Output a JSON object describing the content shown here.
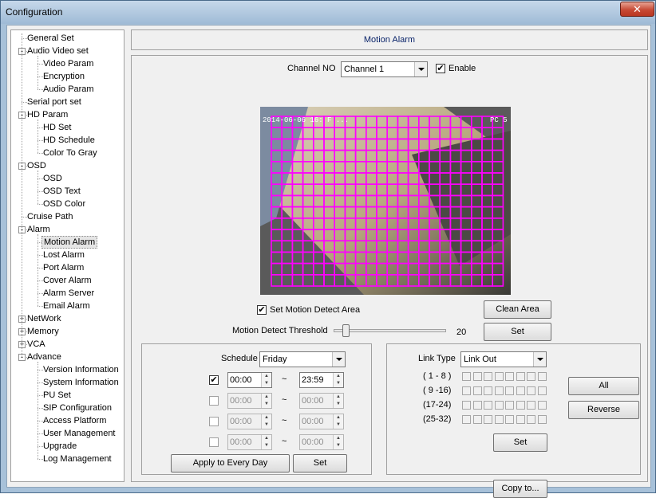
{
  "window": {
    "title": "Configuration",
    "close": "✕"
  },
  "tree": [
    {
      "label": "General Set",
      "level": 0,
      "exp": null
    },
    {
      "label": "Audio Video set",
      "level": 0,
      "exp": "-"
    },
    {
      "label": "Video Param",
      "level": 1,
      "exp": null
    },
    {
      "label": "Encryption",
      "level": 1,
      "exp": null
    },
    {
      "label": "Audio Param",
      "level": 1,
      "exp": null
    },
    {
      "label": "Serial port set",
      "level": 0,
      "exp": null
    },
    {
      "label": "HD Param",
      "level": 0,
      "exp": "-"
    },
    {
      "label": "HD Set",
      "level": 1,
      "exp": null
    },
    {
      "label": "HD Schedule",
      "level": 1,
      "exp": null
    },
    {
      "label": "Color To Gray",
      "level": 1,
      "exp": null
    },
    {
      "label": "OSD",
      "level": 0,
      "exp": "-"
    },
    {
      "label": "OSD",
      "level": 1,
      "exp": null
    },
    {
      "label": "OSD Text",
      "level": 1,
      "exp": null
    },
    {
      "label": "OSD Color",
      "level": 1,
      "exp": null
    },
    {
      "label": "Cruise Path",
      "level": 0,
      "exp": null
    },
    {
      "label": "Alarm",
      "level": 0,
      "exp": "-"
    },
    {
      "label": "Motion Alarm",
      "level": 1,
      "exp": null,
      "selected": true
    },
    {
      "label": "Lost Alarm",
      "level": 1,
      "exp": null
    },
    {
      "label": "Port Alarm",
      "level": 1,
      "exp": null
    },
    {
      "label": "Cover Alarm",
      "level": 1,
      "exp": null
    },
    {
      "label": "Alarm Server",
      "level": 1,
      "exp": null
    },
    {
      "label": "Email Alarm",
      "level": 1,
      "exp": null
    },
    {
      "label": "NetWork",
      "level": 0,
      "exp": "+"
    },
    {
      "label": "Memory",
      "level": 0,
      "exp": "+"
    },
    {
      "label": "VCA",
      "level": 0,
      "exp": "+"
    },
    {
      "label": "Advance",
      "level": 0,
      "exp": "-"
    },
    {
      "label": "Version Information",
      "level": 1,
      "exp": null
    },
    {
      "label": "System Information",
      "level": 1,
      "exp": null
    },
    {
      "label": "PU Set",
      "level": 1,
      "exp": null
    },
    {
      "label": "SIP Configuration",
      "level": 1,
      "exp": null
    },
    {
      "label": "Access Platform",
      "level": 1,
      "exp": null
    },
    {
      "label": "User Management",
      "level": 1,
      "exp": null
    },
    {
      "label": "Upgrade",
      "level": 1,
      "exp": null
    },
    {
      "label": "Log Management",
      "level": 1,
      "exp": null
    }
  ],
  "header": "Motion Alarm",
  "channel": {
    "label": "Channel NO",
    "value": "Channel  1",
    "enable_label": "Enable",
    "enable_checked": true
  },
  "camera": {
    "osd_left": "2014-06-06 16: F ...",
    "osd_right": "PC 5",
    "grid_color": "#ff00ff"
  },
  "detect": {
    "set_area_label": "Set Motion Detect Area",
    "set_area_checked": true,
    "clean_label": "Clean Area",
    "threshold_label": "Motion Detect Threshold",
    "threshold_value": "20",
    "threshold_fraction": 0.2,
    "set_label": "Set"
  },
  "schedule": {
    "label": "Schedule",
    "day": "Friday",
    "tilde": "~",
    "rows": [
      {
        "checked": true,
        "enabled": true,
        "start": "00:00",
        "end": "23:59"
      },
      {
        "checked": false,
        "enabled": false,
        "start": "00:00",
        "end": "00:00"
      },
      {
        "checked": false,
        "enabled": false,
        "start": "00:00",
        "end": "00:00"
      },
      {
        "checked": false,
        "enabled": false,
        "start": "00:00",
        "end": "00:00"
      }
    ],
    "apply_label": "Apply to Every Day",
    "set_label": "Set"
  },
  "link": {
    "label": "Link Type",
    "value": "Link Out",
    "groups": [
      "( 1 - 8 )",
      "( 9 -16)",
      "(17-24)",
      "(25-32)"
    ],
    "all_label": "All",
    "reverse_label": "Reverse",
    "set_label": "Set"
  },
  "copy_label": "Copy to..."
}
